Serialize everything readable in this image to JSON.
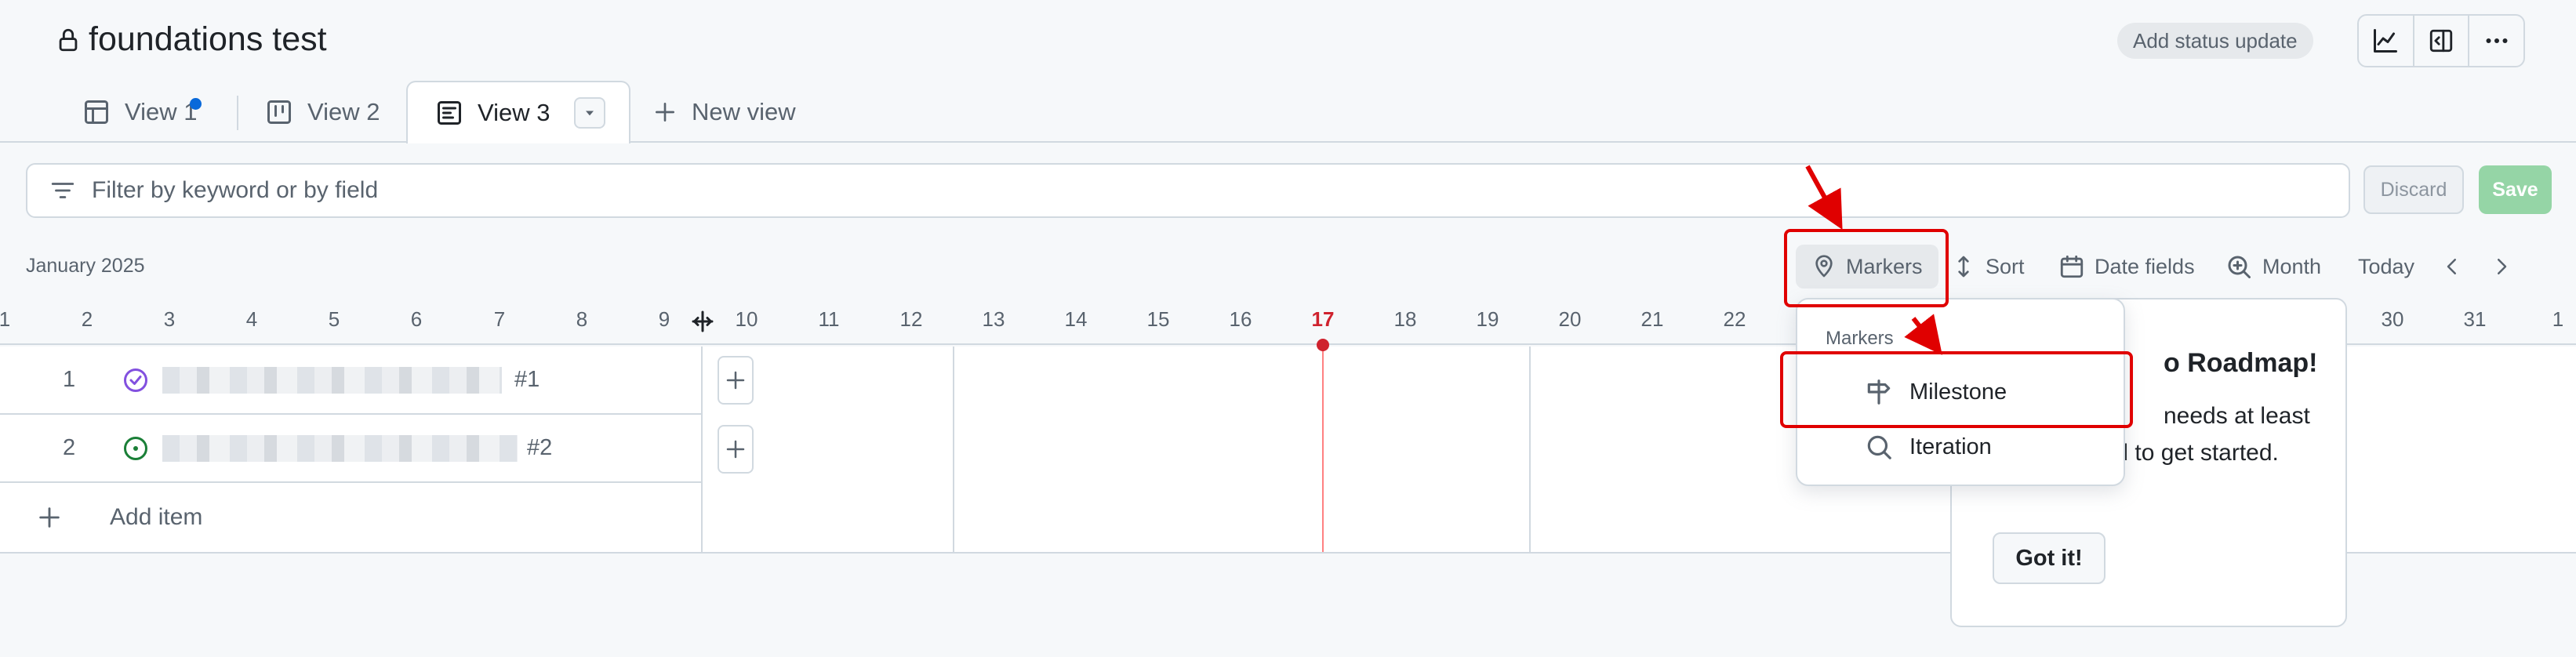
{
  "header": {
    "title": "foundations test",
    "status_button": "Add status update"
  },
  "tabs": [
    {
      "label": "View 1"
    },
    {
      "label": "View 2"
    },
    {
      "label": "View 3"
    },
    {
      "label": "New view"
    }
  ],
  "filter": {
    "placeholder": "Filter by keyword or by field",
    "discard_label": "Discard",
    "save_label": "Save"
  },
  "toolbar": {
    "month_label": "January 2025",
    "markers": "Markers",
    "sort": "Sort",
    "date_fields": "Date fields",
    "zoom": "Month",
    "today": "Today"
  },
  "days": [
    "1",
    "2",
    "3",
    "4",
    "5",
    "6",
    "7",
    "8",
    "9",
    "10",
    "11",
    "12",
    "13",
    "14",
    "15",
    "16",
    "17",
    "18",
    "19",
    "20",
    "21",
    "22",
    "30",
    "31",
    "1"
  ],
  "today_day": "17",
  "rows": [
    {
      "num": "1",
      "issue": "#1",
      "status": "closed"
    },
    {
      "num": "2",
      "issue": "#2",
      "status": "open"
    }
  ],
  "add_item_label": "Add item",
  "markers_menu": {
    "heading": "Markers",
    "items": [
      "Milestone",
      "Iteration"
    ]
  },
  "onboarding": {
    "heading": "o Roadmap!",
    "body": "needs at least iteration field to get started.",
    "button": "Got it!"
  },
  "colors": {
    "accent": "#0969da",
    "today": "#cf222e",
    "save_disabled": "#95d5a6",
    "annotation": "#e00000"
  }
}
